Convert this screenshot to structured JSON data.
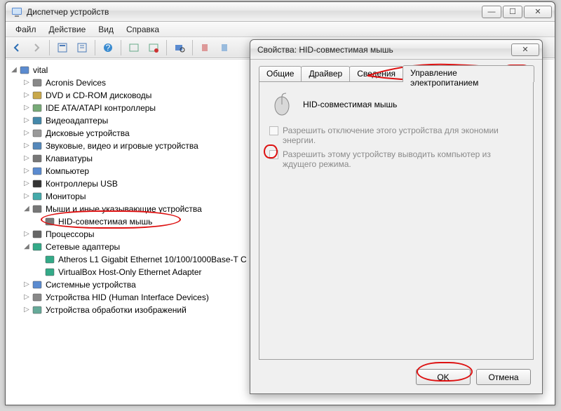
{
  "window": {
    "title": "Диспетчер устройств",
    "menus": [
      "Файл",
      "Действие",
      "Вид",
      "Справка"
    ]
  },
  "tree": {
    "root": "vital",
    "items": [
      {
        "label": "Acronis Devices",
        "icon": "gear"
      },
      {
        "label": "DVD и CD-ROM дисководы",
        "icon": "disc"
      },
      {
        "label": "IDE ATA/ATAPI контроллеры",
        "icon": "ide"
      },
      {
        "label": "Видеоадаптеры",
        "icon": "display"
      },
      {
        "label": "Дисковые устройства",
        "icon": "disk"
      },
      {
        "label": "Звуковые, видео и игровые устройства",
        "icon": "sound"
      },
      {
        "label": "Клавиатуры",
        "icon": "keyboard"
      },
      {
        "label": "Компьютер",
        "icon": "computer"
      },
      {
        "label": "Контроллеры USB",
        "icon": "usb"
      },
      {
        "label": "Мониторы",
        "icon": "monitor"
      },
      {
        "label": "Мыши и иные указывающие устройства",
        "icon": "mouse",
        "expanded": true,
        "children": [
          {
            "label": "HID-совместимая мышь",
            "icon": "mouse"
          }
        ]
      },
      {
        "label": "Процессоры",
        "icon": "cpu"
      },
      {
        "label": "Сетевые адаптеры",
        "icon": "net",
        "expanded": true,
        "children": [
          {
            "label": "Atheros L1 Gigabit Ethernet 10/100/1000Base-T C",
            "icon": "nic"
          },
          {
            "label": "VirtualBox Host-Only Ethernet Adapter",
            "icon": "nic"
          }
        ]
      },
      {
        "label": "Системные устройства",
        "icon": "system"
      },
      {
        "label": "Устройства HID (Human Interface Devices)",
        "icon": "hid"
      },
      {
        "label": "Устройства обработки изображений",
        "icon": "imaging"
      }
    ]
  },
  "dialog": {
    "title": "Свойства: HID-совместимая мышь",
    "tabs": [
      "Общие",
      "Драйвер",
      "Сведения",
      "Управление электропитанием"
    ],
    "active_tab": 3,
    "device_name": "HID-совместимая мышь",
    "chk1": "Разрешить отключение этого устройства для экономии энергии.",
    "chk2": "Разрешить этому устройству выводить компьютер из ждущего режима.",
    "ok": "OK",
    "cancel": "Отмена"
  }
}
